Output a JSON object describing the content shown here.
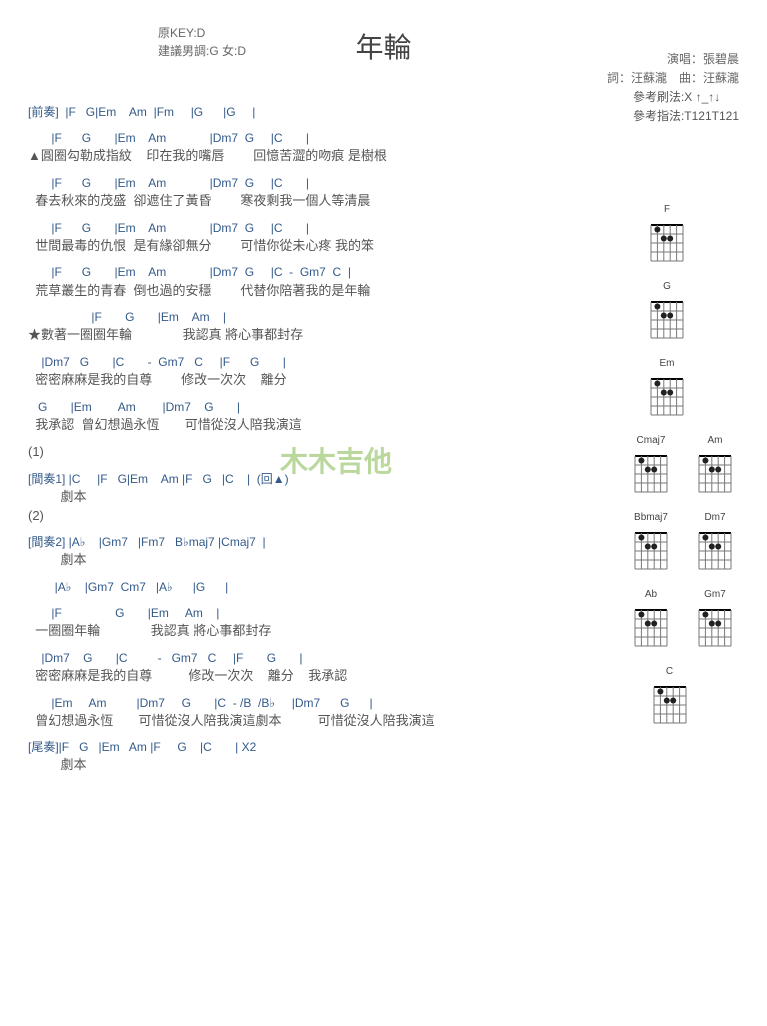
{
  "header": {
    "originalKey": "原KEY:D",
    "suggested": "建議男調:G 女:D",
    "title": "年輪",
    "singer": "演唱：張碧晨",
    "credits": "詞：汪蘇瀧　曲：汪蘇瀧"
  },
  "reference": {
    "strum": "參考刷法:X ↑_↑↓",
    "finger": "參考指法:T121T121"
  },
  "chart_data": {
    "type": "table",
    "title": "年輪 — 和弦譜",
    "diagrams": [
      "F",
      "G",
      "Em",
      "Am",
      "Cmaj7",
      "Bbmaj7",
      "Dm7",
      "Ab",
      "Gm7",
      "C"
    ]
  },
  "lines": [
    {
      "cls": "chordline",
      "t": "[前奏]  |F   G|Em    Am  |Fm     |G      |G     |"
    },
    {
      "cls": "section",
      "t": ""
    },
    {
      "cls": "chordline",
      "t": "       |F      G       |Em    Am             |Dm7  G     |C       |"
    },
    {
      "cls": "lyricline",
      "t": "▲圓圈勾勒成指紋    印在我的嘴唇        回憶苦澀的吻痕 是樹根"
    },
    {
      "cls": "chordline",
      "t": "       |F      G       |Em    Am             |Dm7  G     |C       |"
    },
    {
      "cls": "lyricline",
      "t": "  春去秋來的茂盛  卻遮住了黃昏        寒夜剩我一個人等清晨"
    },
    {
      "cls": "chordline",
      "t": "       |F      G       |Em    Am             |Dm7  G     |C       |"
    },
    {
      "cls": "lyricline",
      "t": "  世間最毒的仇恨  是有緣卻無分        可惜你從未心疼 我的笨"
    },
    {
      "cls": "chordline",
      "t": "       |F      G       |Em    Am             |Dm7  G     |C  -  Gm7  C  |"
    },
    {
      "cls": "lyricline",
      "t": "  荒草叢生的青春  倒也過的安穩        代替你陪著我的是年輪"
    },
    {
      "cls": "section",
      "t": ""
    },
    {
      "cls": "chordline",
      "t": "                   |F       G       |Em    Am    |"
    },
    {
      "cls": "lyricline",
      "t": "★數著一圈圈年輪              我認真 將心事都封存"
    },
    {
      "cls": "chordline",
      "t": "    |Dm7   G       |C       -  Gm7   C     |F      G       |"
    },
    {
      "cls": "lyricline",
      "t": "  密密麻麻是我的自尊        修改一次次    離分"
    },
    {
      "cls": "chordline",
      "t": "   G       |Em        Am        |Dm7    G       |"
    },
    {
      "cls": "lyricline",
      "t": "  我承認  曾幻想過永恆       可惜從沒人陪我演這"
    },
    {
      "cls": "section",
      "t": ""
    },
    {
      "cls": "lyricline",
      "t": "(1)"
    },
    {
      "cls": "chordline",
      "t": "[間奏1] |C     |F   G|Em    Am |F   G   |C    |  (回▲)"
    },
    {
      "cls": "lyricline",
      "t": "         劇本"
    },
    {
      "cls": "lyricline",
      "t": "(2)"
    },
    {
      "cls": "chordline",
      "t": "[間奏2] |A♭    |Gm7   |Fm7   B♭maj7 |Cmaj7  |"
    },
    {
      "cls": "lyricline",
      "t": "         劇本"
    },
    {
      "cls": "chordline",
      "t": "        |A♭    |Gm7  Cm7   |A♭      |G      |"
    },
    {
      "cls": "section",
      "t": ""
    },
    {
      "cls": "chordline",
      "t": "       |F                G       |Em     Am    |"
    },
    {
      "cls": "lyricline",
      "t": "  一圈圈年輪              我認真 將心事都封存"
    },
    {
      "cls": "chordline",
      "t": "    |Dm7    G       |C         -   Gm7   C     |F       G       |"
    },
    {
      "cls": "lyricline",
      "t": "  密密麻麻是我的自尊          修改一次次    離分    我承認"
    },
    {
      "cls": "chordline",
      "t": "       |Em     Am         |Dm7     G       |C  - /B  /B♭     |Dm7      G      |"
    },
    {
      "cls": "lyricline",
      "t": "  曾幻想過永恆       可惜從沒人陪我演這劇本          可惜從沒人陪我演這"
    },
    {
      "cls": "section",
      "t": ""
    },
    {
      "cls": "chordline",
      "t": "[尾奏]|F   G   |Em   Am |F     G    |C       | X2"
    },
    {
      "cls": "lyricline",
      "t": "         劇本"
    }
  ],
  "watermark": "木木吉他"
}
